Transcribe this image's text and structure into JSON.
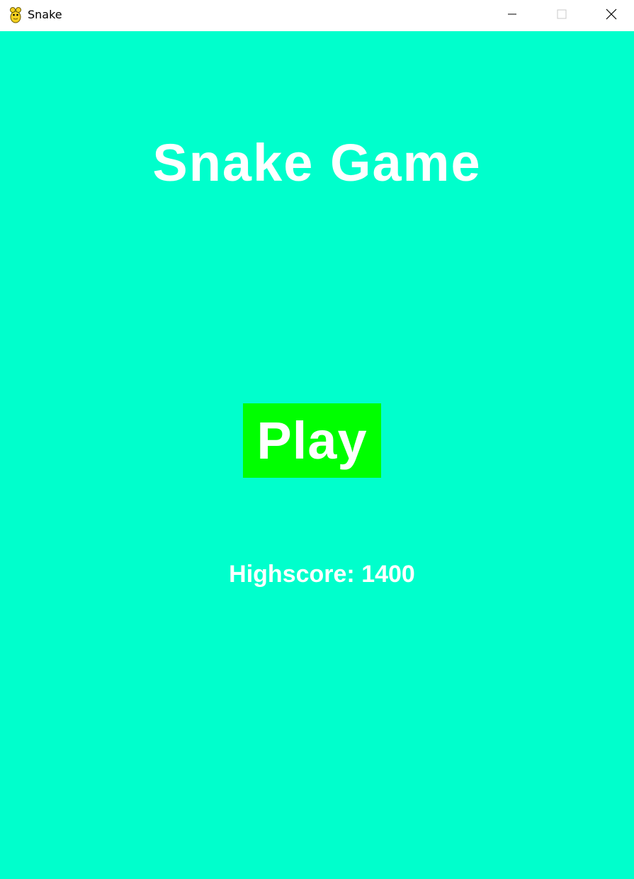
{
  "window": {
    "title": "Snake",
    "icon": "pygame-snake-icon",
    "controls": {
      "minimize_icon": "minimize-icon",
      "maximize_icon": "maximize-icon",
      "close_icon": "close-icon"
    }
  },
  "menu": {
    "title": "Snake Game",
    "play_label": "Play",
    "highscore_text": "Highscore: 1400"
  },
  "colors": {
    "background": "#00ffcc",
    "play_button": "#00ff00",
    "text": "#ffffff"
  }
}
